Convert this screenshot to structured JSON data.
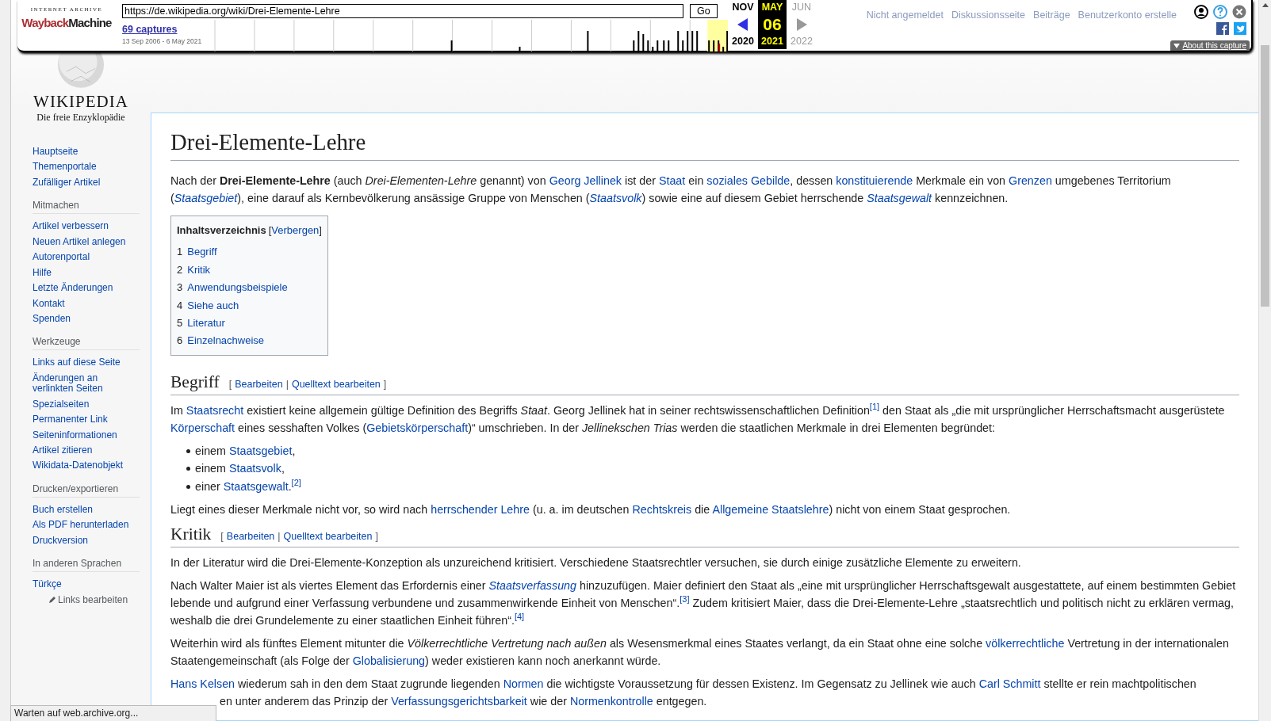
{
  "wayback": {
    "logo_top": "INTERNET ARCHIVE",
    "logo_wayback": "Wayback",
    "logo_machine": "Machine",
    "url": "https://de.wikipedia.org/wiki/Drei-Elemente-Lehre",
    "go": "Go",
    "captures": "69 captures",
    "range": "13 Sep 2006 - 6 May 2021",
    "months": [
      {
        "kind": "prev",
        "month": "NOV",
        "year": "2020",
        "enabled": true
      },
      {
        "kind": "current",
        "month": "MAY",
        "day": "06",
        "year": "2021"
      },
      {
        "kind": "next",
        "month": "JUN",
        "year": "2022",
        "enabled": false
      }
    ],
    "about": "About this capture"
  },
  "header_links": [
    "Nicht angemeldet",
    "Diskussionsseite",
    "Beiträge",
    "Benutzerkonto erstelle"
  ],
  "logo": {
    "title": "WIKIPEDIA",
    "tagline": "Die freie Enzyklopädie"
  },
  "sidebar": [
    {
      "items": [
        {
          "kind": "link",
          "label": "Hauptseite"
        },
        {
          "kind": "link",
          "label": "Themenportale"
        },
        {
          "kind": "link",
          "label": "Zufälliger Artikel"
        }
      ]
    },
    {
      "heading": "Mitmachen",
      "items": [
        {
          "kind": "link",
          "label": "Artikel verbessern"
        },
        {
          "kind": "link",
          "label": "Neuen Artikel anlegen"
        },
        {
          "kind": "link",
          "label": "Autorenportal"
        },
        {
          "kind": "link",
          "label": "Hilfe"
        },
        {
          "kind": "link",
          "label": "Letzte Änderungen"
        },
        {
          "kind": "link",
          "label": "Kontakt"
        },
        {
          "kind": "link",
          "label": "Spenden"
        }
      ]
    },
    {
      "heading": "Werkzeuge",
      "items": [
        {
          "kind": "link",
          "label": "Links auf diese Seite"
        },
        {
          "kind": "link",
          "label": "Änderungen an verlinkten Seiten"
        },
        {
          "kind": "link",
          "label": "Spezialseiten"
        },
        {
          "kind": "link",
          "label": "Permanenter Link"
        },
        {
          "kind": "link",
          "label": "Seiteninformationen"
        },
        {
          "kind": "link",
          "label": "Artikel zitieren"
        },
        {
          "kind": "link",
          "label": "Wikidata-Datenobjekt"
        }
      ]
    },
    {
      "heading": "Drucken/exportieren",
      "items": [
        {
          "kind": "link",
          "label": "Buch erstellen"
        },
        {
          "kind": "link",
          "label": "Als PDF herunterladen"
        },
        {
          "kind": "link",
          "label": "Druckversion"
        }
      ]
    },
    {
      "heading": "In anderen Sprachen",
      "items": [
        {
          "kind": "link",
          "label": "Türkçe"
        },
        {
          "kind": "edit",
          "label": "Links bearbeiten"
        }
      ]
    }
  ],
  "article": {
    "title": "Drei-Elemente-Lehre",
    "intro": [
      {
        "kind": "text",
        "text": "Nach der **Drei-Elemente-Lehre** (auch *Drei-Elementen-Lehre* genannt) von "
      },
      {
        "kind": "link",
        "text": "Georg Jellinek"
      },
      {
        "kind": "text",
        "text": " ist der "
      },
      {
        "kind": "link",
        "text": "Staat"
      },
      {
        "kind": "text",
        "text": " ein "
      },
      {
        "kind": "link",
        "text": "soziales Gebilde"
      },
      {
        "kind": "text",
        "text": ", dessen "
      },
      {
        "kind": "link",
        "text": "konstituierende"
      },
      {
        "kind": "text",
        "text": " Merkmale ein von "
      },
      {
        "kind": "link",
        "text": "Grenzen"
      },
      {
        "kind": "text",
        "text": " umgebenes Territorium ("
      },
      {
        "kind": "link",
        "text": "*Staatsgebiet*"
      },
      {
        "kind": "text",
        "text": "), eine darauf als Kernbevölkerung ansässige Gruppe von Menschen ("
      },
      {
        "kind": "link",
        "text": "*Staatsvolk*"
      },
      {
        "kind": "text",
        "text": ") sowie eine auf diesem Gebiet herrschende "
      },
      {
        "kind": "link",
        "text": "*Staatsgewalt*"
      },
      {
        "kind": "text",
        "text": " kennzeichnen."
      }
    ],
    "toc": {
      "title": "Inhaltsverzeichnis",
      "open": "[",
      "toggle": "Verbergen",
      "close": "]",
      "items": [
        {
          "number": "1",
          "label": "Begriff"
        },
        {
          "number": "2",
          "label": "Kritik"
        },
        {
          "number": "3",
          "label": "Anwendungsbeispiele"
        },
        {
          "number": "4",
          "label": "Siehe auch"
        },
        {
          "number": "5",
          "label": "Literatur"
        },
        {
          "number": "6",
          "label": "Einzelnachweise"
        }
      ]
    },
    "sections": [
      {
        "heading": "Begriff",
        "edit": {
          "open": "[",
          "links": [
            "Bearbeiten",
            "Quelltext bearbeiten"
          ],
          "separator": "|",
          "close": "]"
        },
        "blocks": [
          {
            "kind": "paragraph",
            "runs": [
              {
                "kind": "text",
                "text": "Im "
              },
              {
                "kind": "link",
                "text": "Staatsrecht"
              },
              {
                "kind": "text",
                "text": " existiert keine allgemein gültige Definition des Begriffs *Staat*. Georg Jellinek hat in seiner rechtswissenschaftlichen Definition"
              },
              {
                "kind": "ref",
                "text": "[1]"
              },
              {
                "kind": "text",
                "text": " den Staat als „die mit ursprünglicher Herrschaftsmacht ausgerüstete "
              },
              {
                "kind": "link",
                "text": "Körperschaft"
              },
              {
                "kind": "text",
                "text": " eines sesshaften Volkes ("
              },
              {
                "kind": "link",
                "text": "Gebietskörperschaft"
              },
              {
                "kind": "text",
                "text": ")“ umschrieben. In der *Jellinekschen Trias* werden die staatlichen Merkmale in drei Elementen begründet:"
              }
            ]
          },
          {
            "kind": "list",
            "items": [
              [
                {
                  "kind": "text",
                  "text": "einem "
                },
                {
                  "kind": "link",
                  "text": "Staatsgebiet"
                },
                {
                  "kind": "text",
                  "text": ","
                }
              ],
              [
                {
                  "kind": "text",
                  "text": "einem "
                },
                {
                  "kind": "link",
                  "text": "Staatsvolk"
                },
                {
                  "kind": "text",
                  "text": ","
                }
              ],
              [
                {
                  "kind": "text",
                  "text": "einer "
                },
                {
                  "kind": "link",
                  "text": "Staatsgewalt"
                },
                {
                  "kind": "text",
                  "text": "."
                },
                {
                  "kind": "ref",
                  "text": "[2]"
                }
              ]
            ]
          },
          {
            "kind": "paragraph",
            "runs": [
              {
                "kind": "text",
                "text": "Liegt eines dieser Merkmale nicht vor, so wird nach "
              },
              {
                "kind": "link",
                "text": "herrschender Lehre"
              },
              {
                "kind": "text",
                "text": " (u. a. im deutschen "
              },
              {
                "kind": "link",
                "text": "Rechtskreis"
              },
              {
                "kind": "text",
                "text": " die "
              },
              {
                "kind": "link",
                "text": "Allgemeine Staatslehre"
              },
              {
                "kind": "text",
                "text": ") nicht von einem Staat gesprochen."
              }
            ]
          }
        ]
      },
      {
        "heading": "Kritik",
        "edit": {
          "open": "[",
          "links": [
            "Bearbeiten",
            "Quelltext bearbeiten"
          ],
          "separator": "|",
          "close": "]"
        },
        "blocks": [
          {
            "kind": "paragraph",
            "runs": [
              {
                "kind": "text",
                "text": "In der Literatur wird die Drei-Elemente-Konzeption als unzureichend kritisiert. Verschiedene Staatsrechtler versuchen, sie durch einige zusätzliche Elemente zu erweitern."
              }
            ]
          },
          {
            "kind": "paragraph",
            "runs": [
              {
                "kind": "text",
                "text": "Nach Walter Maier ist als viertes Element das Erfordernis einer "
              },
              {
                "kind": "link",
                "text": "*Staatsverfassung*"
              },
              {
                "kind": "text",
                "text": " hinzuzufügen. Maier definiert den Staat als „eine mit ursprünglicher Herrschaftsgewalt ausgestattete, auf einem bestimmten Gebiet lebende und aufgrund einer Verfassung verbundene und zusammenwirkende Einheit von Menschen“."
              },
              {
                "kind": "ref",
                "text": "[3]"
              },
              {
                "kind": "text",
                "text": " Zudem kritisiert Maier, dass die Drei-Elemente-Lehre „staatsrechtlich und politisch nicht zu erklären vermag, weshalb die drei Grundelemente zu einer staatlichen Einheit führen“."
              },
              {
                "kind": "ref",
                "text": "[4]"
              }
            ]
          },
          {
            "kind": "paragraph",
            "runs": [
              {
                "kind": "text",
                "text": "Weiterhin wird als fünftes Element mitunter die *Völkerrechtliche Vertretung nach außen* als Wesensmerkmal eines Staates verlangt, da ein Staat ohne eine solche "
              },
              {
                "kind": "link",
                "text": "völkerrechtliche"
              },
              {
                "kind": "text",
                "text": " Vertretung in der internationalen Staatengemeinschaft (als Folge der "
              },
              {
                "kind": "link",
                "text": "Globalisierung"
              },
              {
                "kind": "text",
                "text": ") weder existieren kann noch anerkannt würde."
              }
            ]
          },
          {
            "kind": "paragraph",
            "runs": [
              {
                "kind": "link",
                "text": "Hans Kelsen"
              },
              {
                "kind": "text",
                "text": " wiederum sah in den dem Staat zugrunde liegenden "
              },
              {
                "kind": "link",
                "text": "Normen"
              },
              {
                "kind": "text",
                "text": " die wichtigste Voraussetzung für dessen Existenz. Im Gegensatz zu Jellinek wie auch "
              },
              {
                "kind": "link",
                "text": "Carl Schmitt"
              },
              {
                "kind": "text",
                "text": " stellte er rein machtpolitischen"
              },
              {
                "kind": "break"
              },
              {
                "kind": "text",
                "text": "en unter anderem das Prinzip der "
              },
              {
                "kind": "link",
                "text": "Verfassungsgerichtsbarkeit"
              },
              {
                "kind": "text",
                "text": " wie der "
              },
              {
                "kind": "link",
                "text": "Normenkontrolle"
              },
              {
                "kind": "text",
                "text": " entgegen."
              }
            ]
          }
        ]
      }
    ]
  },
  "status_bar": "Warten auf web.archive.org..."
}
